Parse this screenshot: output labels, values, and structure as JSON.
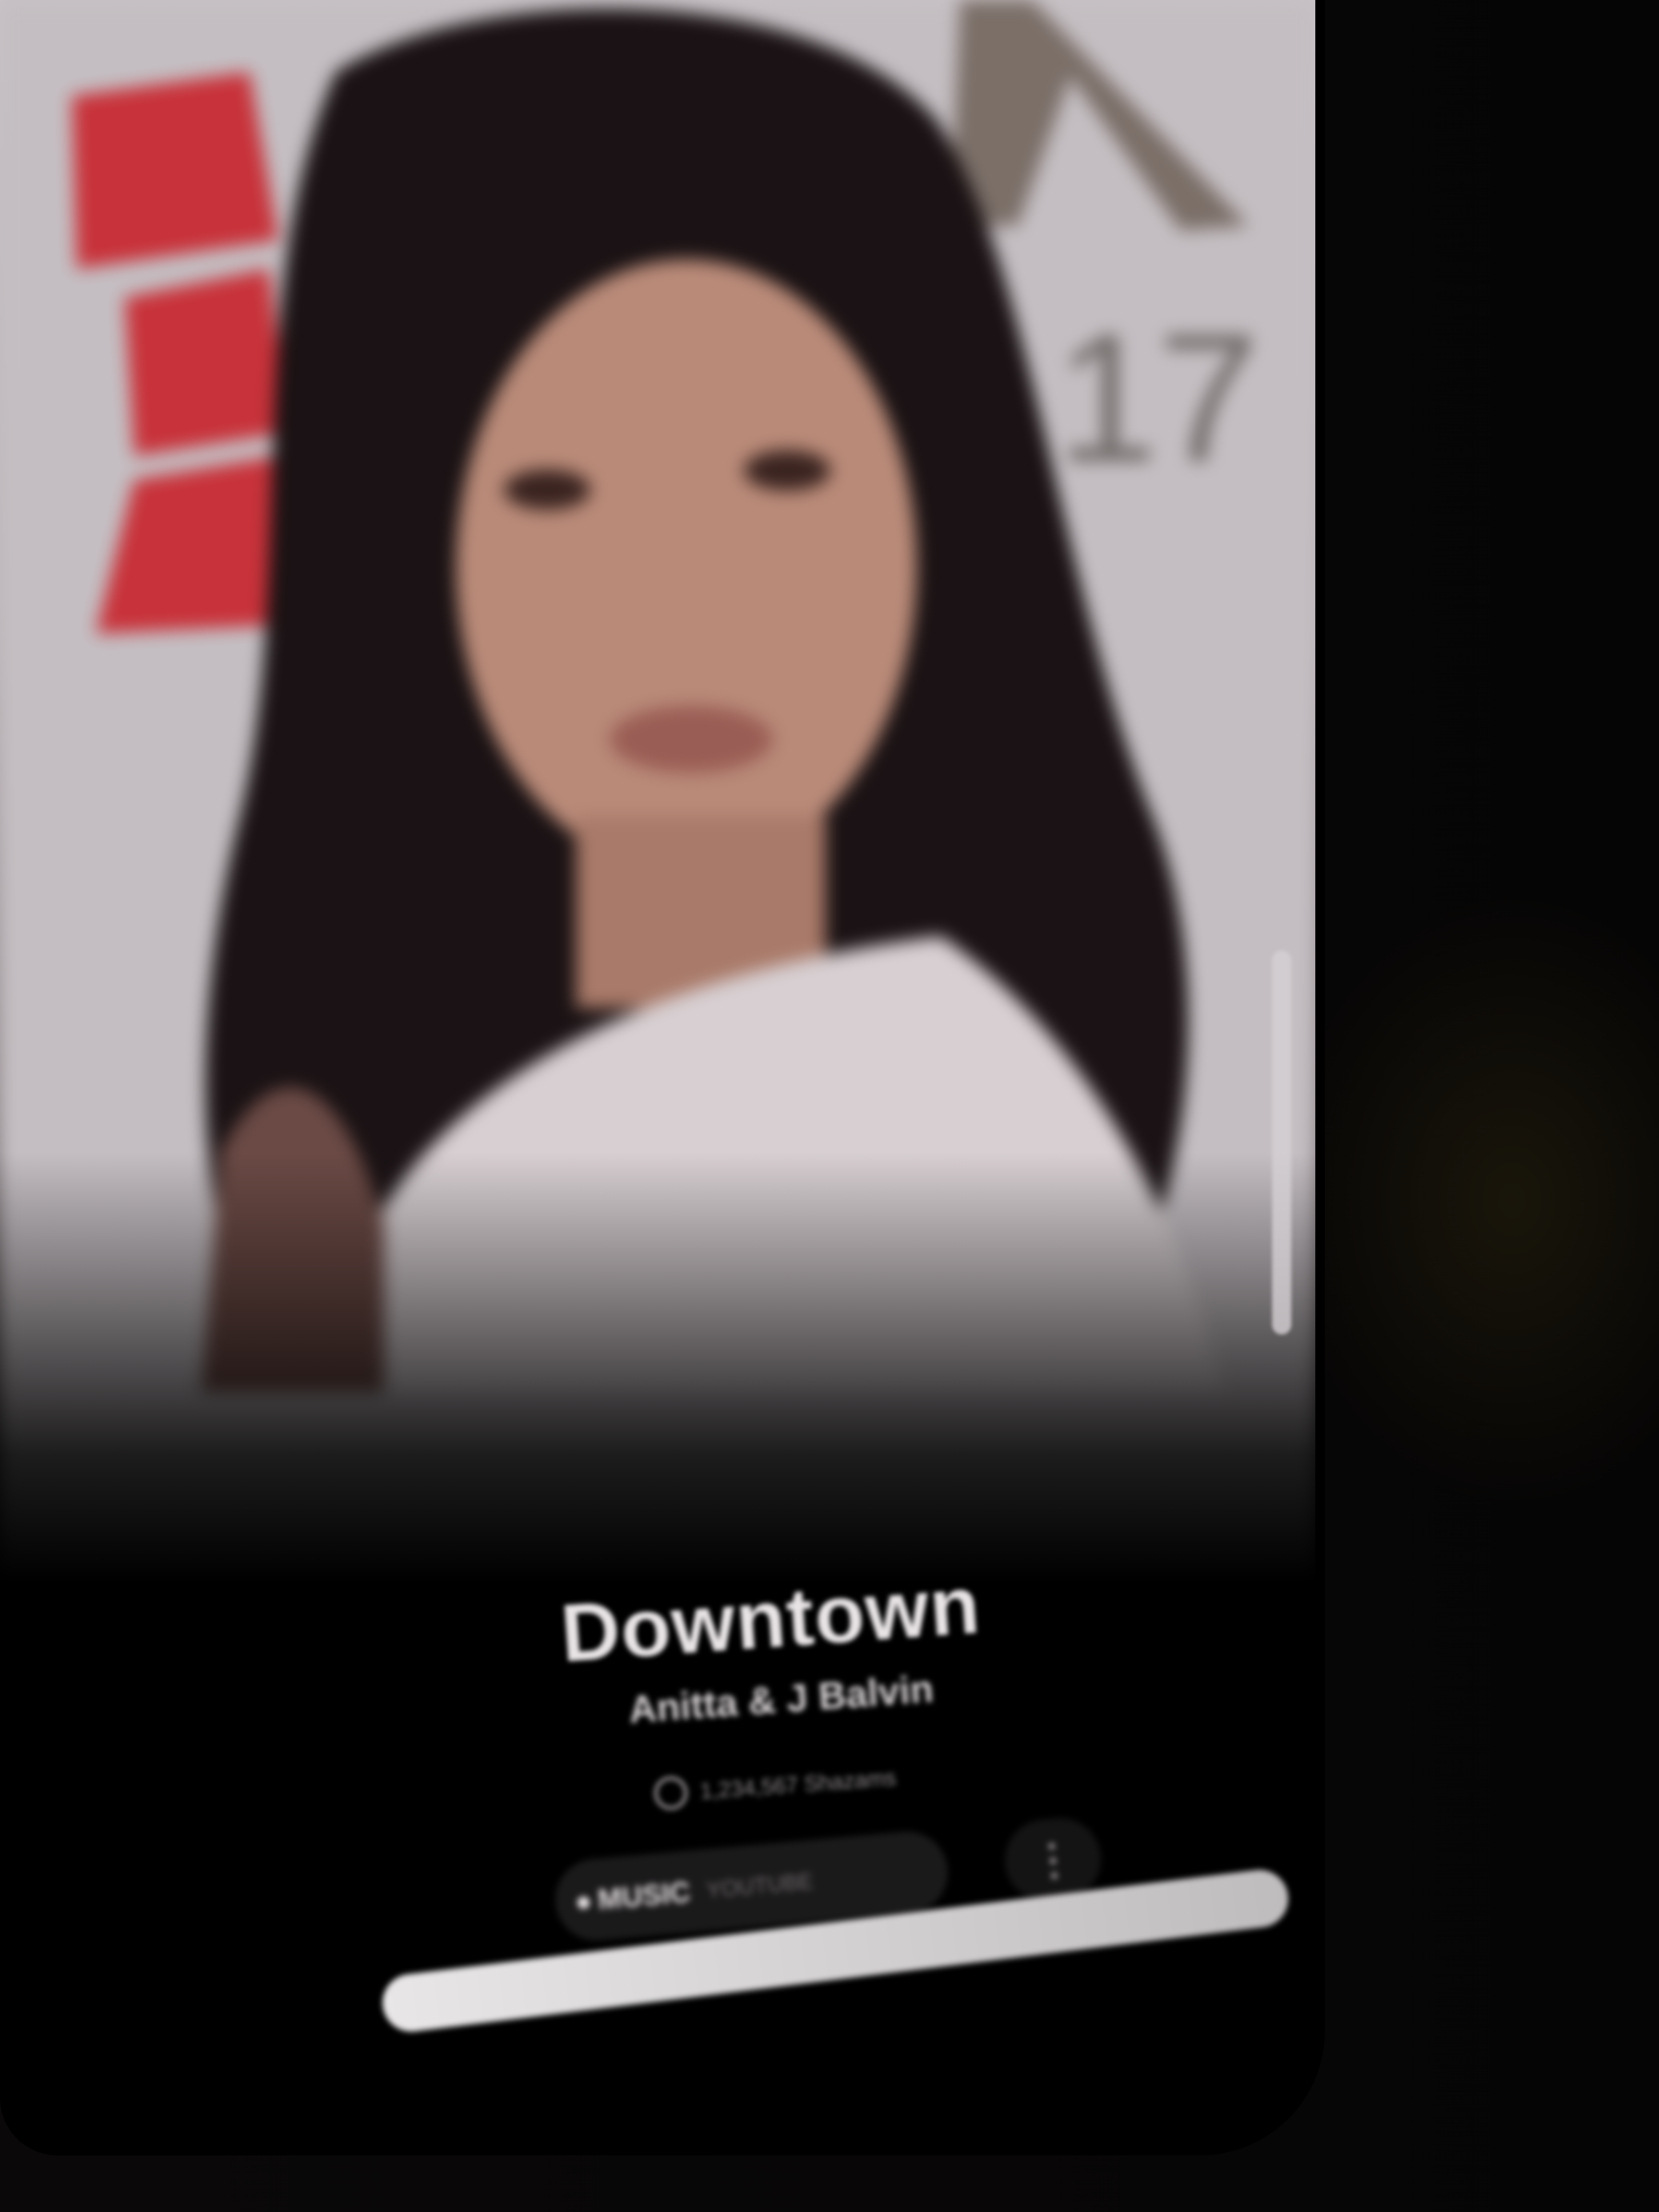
{
  "now_playing": {
    "title": "Downtown",
    "artist": "Anitta & J Balvin",
    "meta": "1,234,567 Shazams"
  },
  "sources": {
    "active_label": "MUSIC",
    "other_label": "YOUTUBE"
  },
  "more_button": {
    "icon": "more-dots-icon",
    "label": "⋮"
  },
  "background_sign": {
    "number": "17"
  },
  "colors": {
    "accent": "#e8e4e6",
    "background": "#000000",
    "sign_red": "#c8323a"
  }
}
